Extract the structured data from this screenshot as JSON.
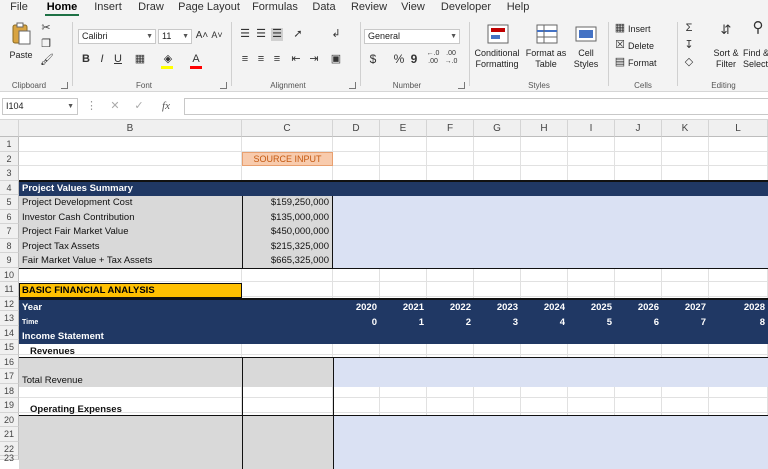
{
  "menu": {
    "tabs": [
      "File",
      "Home",
      "Insert",
      "Draw",
      "Page Layout",
      "Formulas",
      "Data",
      "Review",
      "View",
      "Developer",
      "Help"
    ],
    "active": "Home"
  },
  "ribbon": {
    "clipboard": {
      "label": "Clipboard",
      "paste": "Paste"
    },
    "font": {
      "label": "Font",
      "name": "Calibri",
      "size": "11",
      "bold": "B",
      "italic": "I",
      "underline": "U",
      "grow": "A˄",
      "shrink": "A˅"
    },
    "alignment": {
      "label": "Alignment"
    },
    "number": {
      "label": "Number",
      "format": "General",
      "currency": "$",
      "percent": "%",
      "comma": "9",
      "inc_dec": "←.0\n.00",
      "dec_dec": ".00\n→.0"
    },
    "styles": {
      "label": "Styles",
      "conditional": "Conditional",
      "conditional2": "Formatting",
      "format_table": "Format as",
      "format_table2": "Table",
      "cell_styles": "Cell",
      "cell_styles2": "Styles"
    },
    "cells": {
      "label": "Cells",
      "insert": "Insert",
      "delete": "Delete",
      "format": "Format"
    },
    "editing": {
      "label": "Editing",
      "sort": "Sort &",
      "sort2": "Filter",
      "find": "Find &",
      "find2": "Select"
    }
  },
  "formula_bar": {
    "name_box": "I104",
    "fx": "fx",
    "cancel": "✕",
    "enter": "✓",
    "value": ""
  },
  "columns": [
    "B",
    "C",
    "D",
    "E",
    "F",
    "G",
    "H",
    "I",
    "J",
    "K",
    "L"
  ],
  "rows": [
    "1",
    "2",
    "3",
    "4",
    "5",
    "6",
    "7",
    "8",
    "9",
    "10",
    "11",
    "12",
    "13",
    "14",
    "15",
    "16",
    "17",
    "18",
    "19",
    "20",
    "21",
    "22",
    "23"
  ],
  "sheet": {
    "source_input": "SOURCE INPUT",
    "summary_header": "Project Values Summary",
    "summary_rows": [
      {
        "label": "Project Development Cost",
        "value": "$159,250,000"
      },
      {
        "label": "Investor Cash Contribution",
        "value": "$135,000,000"
      },
      {
        "label": "Project Fair Market Value",
        "value": "$450,000,000"
      },
      {
        "label": "Project Tax Assets",
        "value": "$215,325,000"
      },
      {
        "label": "Fair Market Value + Tax Assets",
        "value": "$665,325,000"
      }
    ],
    "basic_header": "BASIC FINANCIAL ANALYSIS",
    "year_label": "Year",
    "time_label": "Time",
    "years": [
      "2020",
      "2021",
      "2022",
      "2023",
      "2024",
      "2025",
      "2026",
      "2027",
      "2028"
    ],
    "times": [
      "0",
      "1",
      "2",
      "3",
      "4",
      "5",
      "6",
      "7",
      "8"
    ],
    "income_statement": "Income Statement",
    "revenues": "Revenues",
    "total_revenue": "Total Revenue",
    "operating_expenses": "Operating Expenses"
  },
  "colors": {
    "navy": "#203864",
    "orange": "#f8cbad",
    "gold": "#ffc000",
    "gray": "#d9d9d9",
    "lavender": "#dae1f3",
    "excel_green": "#1e7145"
  }
}
